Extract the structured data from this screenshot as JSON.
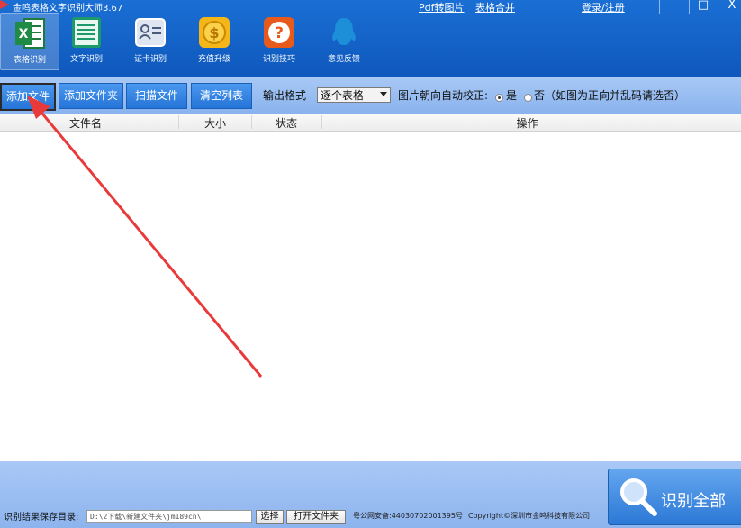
{
  "window": {
    "title": "金鸣表格文字识别大师3.67",
    "links": [
      "Pdf转图片",
      "表格合并",
      "登录/注册"
    ],
    "controls": [
      "—",
      "□",
      "X"
    ]
  },
  "toolbar": [
    {
      "label": "表格识别",
      "icon": "excel-icon",
      "active": true
    },
    {
      "label": "文字识别",
      "icon": "document-icon",
      "active": false
    },
    {
      "label": "证卡识别",
      "icon": "id-card-icon",
      "active": false
    },
    {
      "label": "充值升级",
      "icon": "coin-icon",
      "active": false
    },
    {
      "label": "识别技巧",
      "icon": "help-icon",
      "active": false
    },
    {
      "label": "意见反馈",
      "icon": "qq-penguin-icon",
      "active": false
    }
  ],
  "actions": {
    "add_file": "添加文件",
    "add_folder": "添加文件夹",
    "scan_file": "扫描文件",
    "clear_list": "清空列表",
    "output_format_label": "输出格式",
    "output_format_value": "逐个表格",
    "auto_orient_label": "图片朝向自动校正:",
    "yes": "是",
    "no": "否（如图为正向并乱码请选否）",
    "auto_orient_selected": "是"
  },
  "table": {
    "columns": [
      "文件名",
      "大小",
      "状态",
      "操作"
    ],
    "rows": []
  },
  "footer": {
    "save_dir_label": "识别结果保存目录:",
    "save_dir_value": "D:\\2下载\\新建文件夹\\jm189cn\\",
    "choose_button": "选择",
    "open_folder_button": "打开文件夹",
    "icp": "粤公网安备:44030702001395号",
    "copyright": "Copyright©深圳市金鸣科技有限公司",
    "recognize_all": "识别全部"
  },
  "colors": {
    "toolbar_blue": "#1565cc",
    "button_blue": "#2f7fe0",
    "annotation_arrow": "#e83a3a"
  }
}
